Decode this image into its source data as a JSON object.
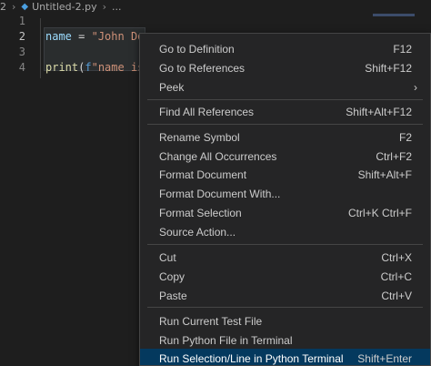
{
  "breadcrumb": {
    "folder_index": "2",
    "file_name": "Untitled-2.py",
    "more": "..."
  },
  "editor": {
    "line_numbers": [
      "1",
      "2",
      "3",
      "4"
    ],
    "lines": {
      "l2_var": "name",
      "l2_op": " = ",
      "l2_str": "\"John Doe",
      "l4_fn": "print",
      "l4_paren": "(",
      "l4_f": "f",
      "l4_str": "\"name is "
    }
  },
  "menu": {
    "items": [
      {
        "label": "Go to Definition",
        "kb": "F12"
      },
      {
        "label": "Go to References",
        "kb": "Shift+F12"
      },
      {
        "label": "Peek",
        "kb": ""
      },
      {
        "label": "Find All References",
        "kb": "Shift+Alt+F12"
      },
      {
        "label": "Rename Symbol",
        "kb": "F2"
      },
      {
        "label": "Change All Occurrences",
        "kb": "Ctrl+F2"
      },
      {
        "label": "Format Document",
        "kb": "Shift+Alt+F"
      },
      {
        "label": "Format Document With...",
        "kb": ""
      },
      {
        "label": "Format Selection",
        "kb": "Ctrl+K Ctrl+F"
      },
      {
        "label": "Source Action...",
        "kb": ""
      },
      {
        "label": "Cut",
        "kb": "Ctrl+X"
      },
      {
        "label": "Copy",
        "kb": "Ctrl+C"
      },
      {
        "label": "Paste",
        "kb": "Ctrl+V"
      },
      {
        "label": "Run Current Test File",
        "kb": ""
      },
      {
        "label": "Run Python File in Terminal",
        "kb": ""
      },
      {
        "label": "Run Selection/Line in Python Terminal",
        "kb": "Shift+Enter"
      }
    ],
    "highlight_color": "#04395e"
  }
}
